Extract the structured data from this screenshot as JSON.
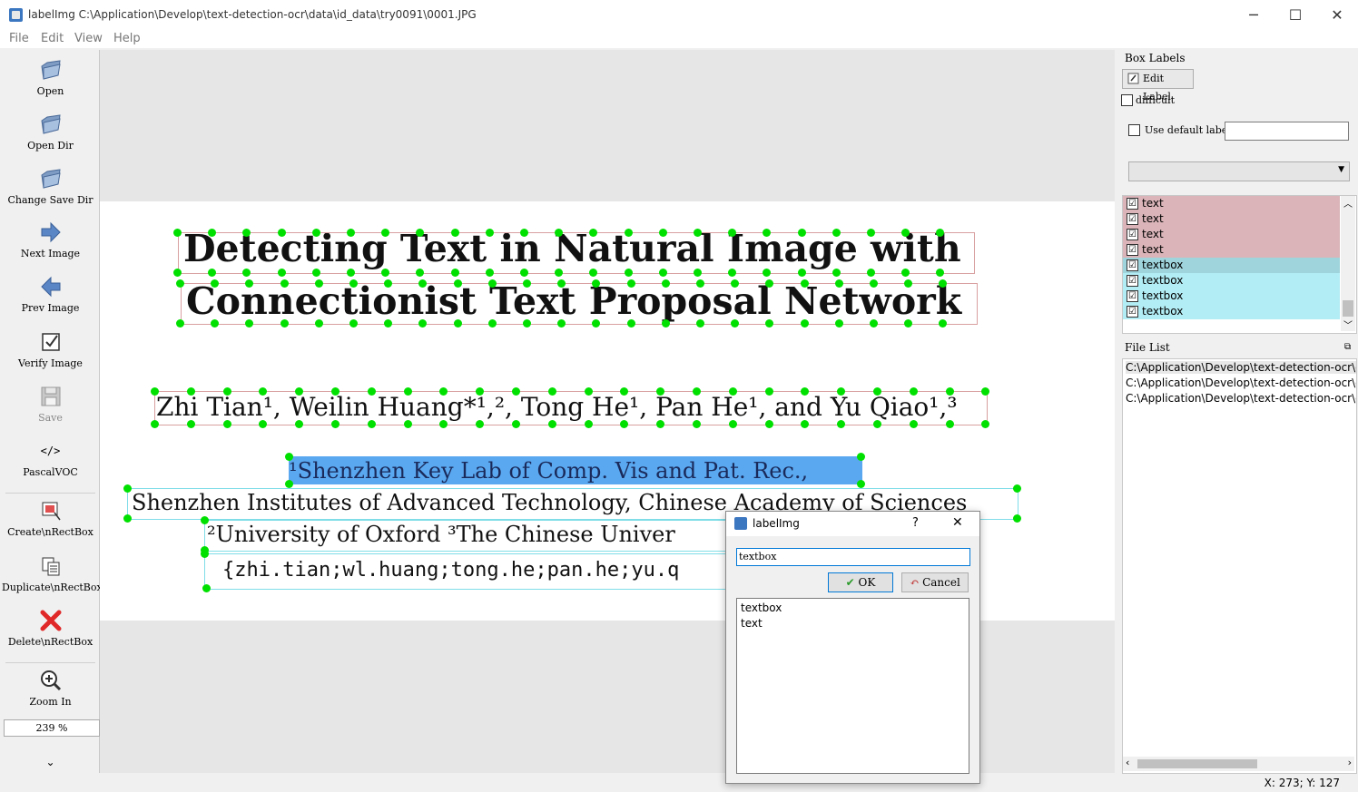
{
  "window": {
    "title": "labelImg C:\\Application\\Develop\\text-detection-ocr\\data\\id_data\\try0091\\0001.JPG",
    "minimize": "─",
    "maximize": "☐",
    "close": "✕"
  },
  "menu": {
    "file": "File",
    "edit": "Edit",
    "view": "View",
    "help": "Help"
  },
  "toolbar": {
    "open": "Open",
    "open_dir": "Open Dir",
    "change_save_dir": "Change Save Dir",
    "next_image": "Next Image",
    "prev_image": "Prev Image",
    "verify_image": "Verify Image",
    "save": "Save",
    "pascalvoc_icon": "</>",
    "pascalvoc": "PascalVOC",
    "create_rectbox": "Create\\nRectBox",
    "duplicate_rectbox": "Duplicate\\nRectBox",
    "delete_rectbox": "Delete\\nRectBox",
    "zoom_in": "Zoom In",
    "zoom_value": "239 %",
    "more": "⌄"
  },
  "document": {
    "title_line1": "Detecting Text in Natural Image with",
    "title_line2": "Connectionist Text Proposal Network",
    "authors": "Zhi Tian¹, Weilin Huang*¹,², Tong He¹, Pan He¹, and Yu Qiao¹,³",
    "affil1": "¹Shenzhen Key Lab of Comp. Vis and Pat. Rec.,",
    "affil2": "Shenzhen Institutes of Advanced Technology, Chinese Academy of Sciences",
    "affil3": "²University of Oxford   ³The Chinese Univer",
    "emails": "{zhi.tian;wl.huang;tong.he;pan.he;yu.q"
  },
  "box_labels": {
    "title": "Box Labels",
    "edit_label": "Edit Label",
    "difficult": "difficult",
    "use_default_label": "Use default label",
    "default_label_value": "",
    "items": [
      {
        "label": "text",
        "checked": "☑"
      },
      {
        "label": "text",
        "checked": "☑"
      },
      {
        "label": "text",
        "checked": "☑"
      },
      {
        "label": "text",
        "checked": "☑"
      },
      {
        "label": "textbox",
        "checked": "☑"
      },
      {
        "label": "textbox",
        "checked": "☑"
      },
      {
        "label": "textbox",
        "checked": "☑"
      },
      {
        "label": "textbox",
        "checked": "☑"
      }
    ]
  },
  "file_list": {
    "title": "File List",
    "files": [
      "C:\\Application\\Develop\\text-detection-ocr\\d",
      "C:\\Application\\Develop\\text-detection-ocr\\d",
      "C:\\Application\\Develop\\text-detection-ocr\\d"
    ]
  },
  "status": {
    "coords": "X: 273; Y: 127"
  },
  "dialog": {
    "title": "labelImg",
    "help": "?",
    "close": "✕",
    "input_value": "textbox",
    "ok": "OK",
    "cancel": "Cancel",
    "options": [
      "textbox",
      "text"
    ]
  },
  "colors": {
    "text_row_bg": "#dab4b8",
    "textbox_row_bg": "#b2ecf4",
    "textbox_row_selected_bg": "#9fd4dc",
    "box_point": "#00e000",
    "selected_box": "#5aa8f0"
  }
}
